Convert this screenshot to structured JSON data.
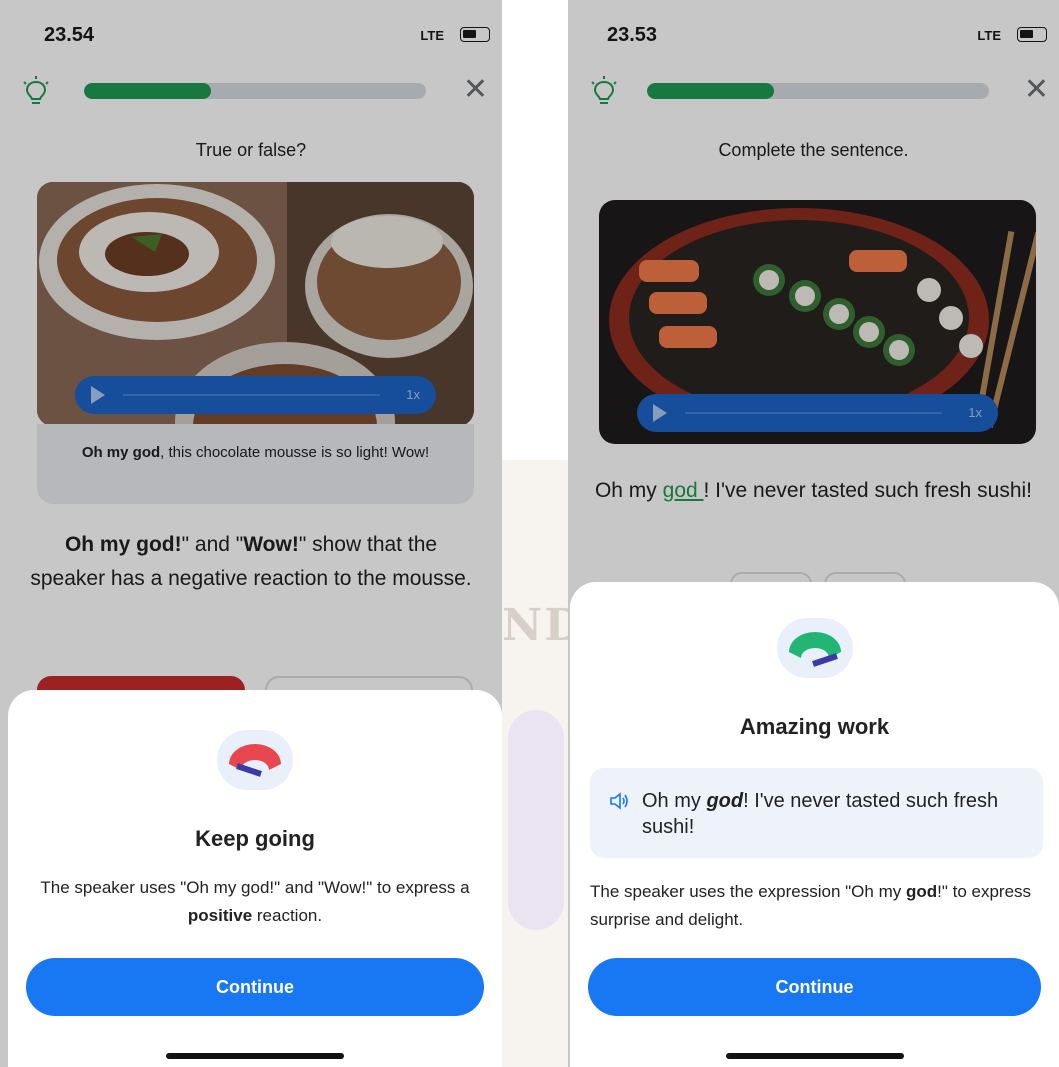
{
  "left": {
    "status": {
      "time": "23.54",
      "network": "LTE"
    },
    "question_prompt": "True or false?",
    "player_speed": "1x",
    "caption_bold": "Oh my god",
    "caption_rest": ", this chocolate mousse is so light! Wow!",
    "statement": {
      "part1": "Oh my god!",
      "part2": "\" and \"",
      "part3": "Wow!",
      "part4": "\" show that the speaker has a negative reaction to the mousse."
    },
    "progress_fraction": 0.37,
    "feedback": {
      "title": "Keep going",
      "body_before": "The speaker uses \"Oh my god!\" and \"Wow!\" to express a ",
      "body_bold": "positive",
      "body_after": " reaction.",
      "continue_label": "Continue",
      "gauge_color": "#e8474f"
    }
  },
  "right": {
    "status": {
      "time": "23.53",
      "network": "LTE"
    },
    "question_prompt": "Complete the sentence.",
    "player_speed": "1x",
    "sentence_before": "Oh my ",
    "sentence_blank": " god ",
    "sentence_after": "! I've never tasted such fresh sushi!",
    "progress_fraction": 0.37,
    "feedback": {
      "title": "Amazing work",
      "audio_before": "Oh my ",
      "audio_bold": "god",
      "audio_after": "! I've never tasted such fresh sushi!",
      "body_before": "The speaker uses the expression \"Oh my ",
      "body_bold": "god",
      "body_after": "!\" to express surprise and delight.",
      "continue_label": "Continue",
      "gauge_color": "#22b573"
    }
  },
  "watermark": "NDI",
  "colors": {
    "progress": "#1f9a52",
    "primary_button": "#1877f2",
    "wrong_answer": "#c82c2c",
    "player": "#1d64c8"
  },
  "icons": [
    "lightbulb-icon",
    "close-icon",
    "play-icon",
    "speaker-icon",
    "gauge-icon",
    "signal-icon",
    "battery-icon"
  ]
}
